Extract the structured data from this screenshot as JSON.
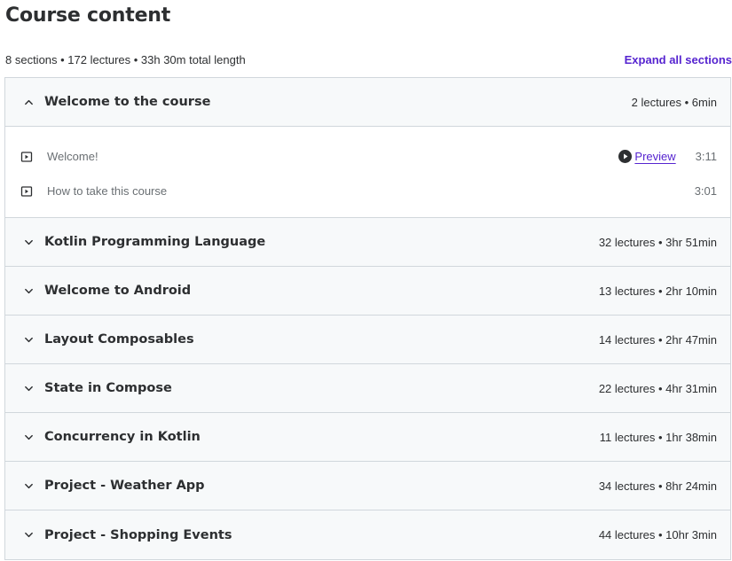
{
  "header": {
    "title": "Course content",
    "summary": "8 sections • 172 lectures • 33h 30m total length",
    "expand_label": "Expand all sections"
  },
  "sections": [
    {
      "title": "Welcome to the course",
      "meta": "2 lectures • 6min",
      "expanded": true,
      "lectures": [
        {
          "title": "Welcome!",
          "preview": "Preview",
          "duration": "3:11"
        },
        {
          "title": "How to take this course",
          "duration": "3:01"
        }
      ]
    },
    {
      "title": "Kotlin Programming Language",
      "meta": "32 lectures • 3hr 51min"
    },
    {
      "title": "Welcome to Android",
      "meta": "13 lectures • 2hr 10min"
    },
    {
      "title": "Layout Composables",
      "meta": "14 lectures • 2hr 47min"
    },
    {
      "title": "State in Compose",
      "meta": "22 lectures • 4hr 31min"
    },
    {
      "title": "Concurrency in Kotlin",
      "meta": "11 lectures • 1hr 38min"
    },
    {
      "title": "Project - Weather App",
      "meta": "34 lectures • 8hr 24min"
    },
    {
      "title": "Project - Shopping Events",
      "meta": "44 lectures • 10hr 3min"
    }
  ],
  "icons": {
    "collapse": "chevron-up-icon",
    "expand": "chevron-down-icon",
    "lecture": "video-icon",
    "preview": "play-circle-icon"
  },
  "colors": {
    "accent": "#5624d0",
    "header_bg": "#f7f9fa",
    "border": "#d1d7dc",
    "text": "#2d2f31",
    "muted": "#6a6f73"
  }
}
